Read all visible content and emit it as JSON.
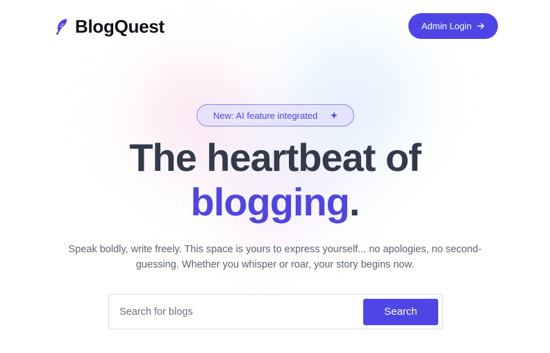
{
  "brand": {
    "name": "BlogQuest",
    "icon": "feather-icon",
    "accent_color": "#4d45e5"
  },
  "header": {
    "admin_label": "Admin Login",
    "admin_icon": "arrow-right-icon"
  },
  "badge": {
    "label": "New: AI feature integrated",
    "icon": "sparkle-icon"
  },
  "hero": {
    "title_line1": "The heartbeat of",
    "title_accent": "blogging",
    "title_punct": ".",
    "subtitle": "Speak boldly, write freely. This space is yours to express yourself... no apologies, no second-guessing. Whether you whisper or roar, your story begins now."
  },
  "search": {
    "placeholder": "Search for blogs",
    "value": "",
    "button_label": "Search"
  }
}
